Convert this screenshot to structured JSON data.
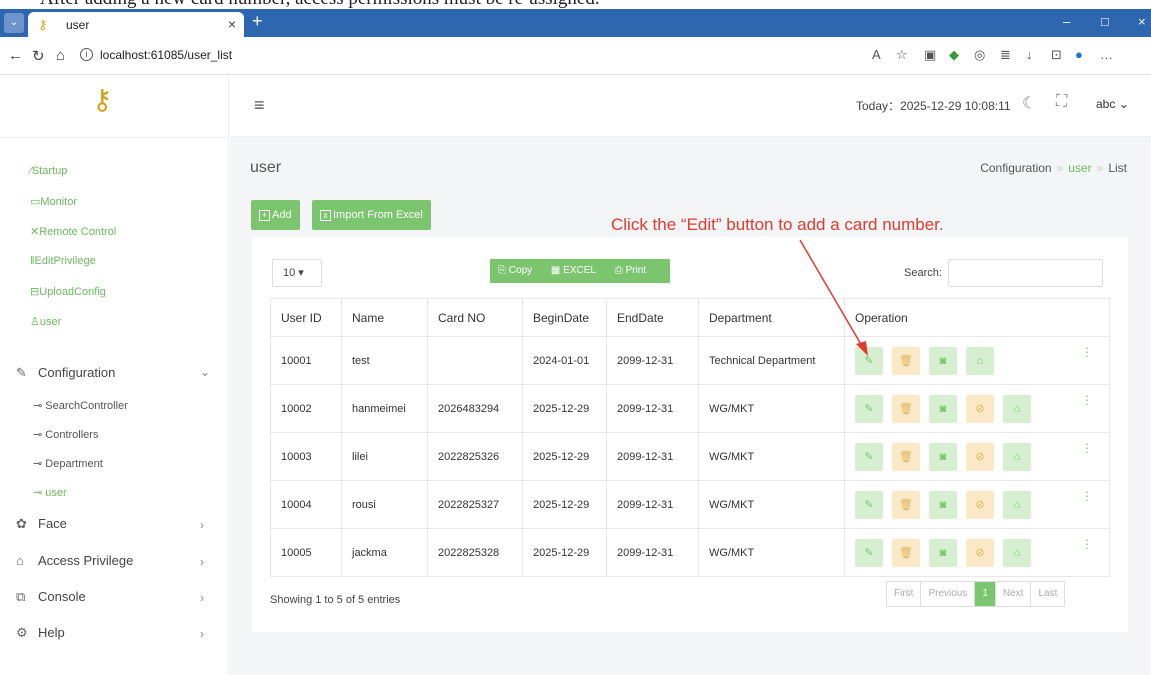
{
  "caption": "After adding a new card number, access permissions must be re-assigned.",
  "browser": {
    "tab_title": "user",
    "url": "localhost:61085/user_list"
  },
  "sidebar": {
    "links": [
      "Startup",
      "Monitor",
      "Remote Control",
      "EditPrivilege",
      "UploadConfig",
      "user"
    ],
    "configuration": {
      "label": "Configuration",
      "items": [
        "SearchController",
        "Controllers",
        "Department",
        "user"
      ]
    },
    "groups": [
      "Face",
      "Access Privilege",
      "Console",
      "Help"
    ]
  },
  "header": {
    "today_label": "Today：2025-12-29 10:08:11",
    "user": "abc"
  },
  "page": {
    "title": "user",
    "breadcrumb": [
      "Configuration",
      "user",
      "List"
    ],
    "add_button": "Add",
    "import_button": "Import From Excel",
    "annotation": "Click the “Edit” button to add a card number."
  },
  "table_controls": {
    "page_length": "10",
    "export": [
      "Copy",
      "EXCEL",
      "Print"
    ],
    "search_label": "Search:"
  },
  "table": {
    "columns": [
      "User ID",
      "Name",
      "Card NO",
      "BeginDate",
      "EndDate",
      "Department",
      "Operation"
    ],
    "rows": [
      [
        "10001",
        "test",
        "",
        "2024-01-01",
        "2099-12-31",
        "Technical Department"
      ],
      [
        "10002",
        "hanmeimei",
        "2026483294",
        "2025-12-29",
        "2099-12-31",
        "WG/MKT"
      ],
      [
        "10003",
        "lilei",
        "2022825326",
        "2025-12-29",
        "2099-12-31",
        "WG/MKT"
      ],
      [
        "10004",
        "rousi",
        "2022825327",
        "2025-12-29",
        "2099-12-31",
        "WG/MKT"
      ],
      [
        "10005",
        "jackma",
        "2022825328",
        "2025-12-29",
        "2099-12-31",
        "WG/MKT"
      ]
    ]
  },
  "footer": {
    "info": "Showing 1 to 5 of 5 entries",
    "pager": [
      "First",
      "Previous",
      "1",
      "Next",
      "Last"
    ]
  },
  "colors": {
    "accent_green": "#7bc56e",
    "annotation_red": "#e23a2e",
    "browser_blue": "#2f66b0"
  }
}
